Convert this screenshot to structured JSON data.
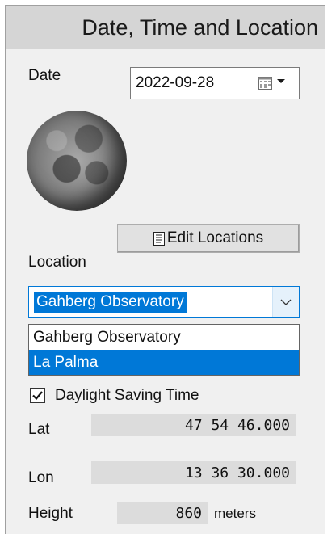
{
  "panel": {
    "title": "Date, Time and Location"
  },
  "date": {
    "label": "Date",
    "value": "2022-09-28"
  },
  "edit_locations_label": "Edit Locations",
  "location": {
    "label": "Location",
    "selected": "Gahberg Observatory",
    "options": [
      "Gahberg Observatory",
      "La Palma"
    ],
    "highlighted_option": "La Palma"
  },
  "daylight_saving": {
    "label": "Daylight Saving Time",
    "checked": true
  },
  "lat": {
    "label": "Lat",
    "value": "47 54 46.000"
  },
  "lon": {
    "label": "Lon",
    "value": "13 36 30.000"
  },
  "height": {
    "label": "Height",
    "value": "860",
    "unit": "meters"
  },
  "colors": {
    "selection": "#0078d7",
    "header": "#d5d5d5",
    "panel": "#f0f0f0"
  },
  "icons": [
    "calendar-icon",
    "dropdown-arrow-icon",
    "edit-list-icon",
    "moon-image",
    "checkmark-icon"
  ]
}
